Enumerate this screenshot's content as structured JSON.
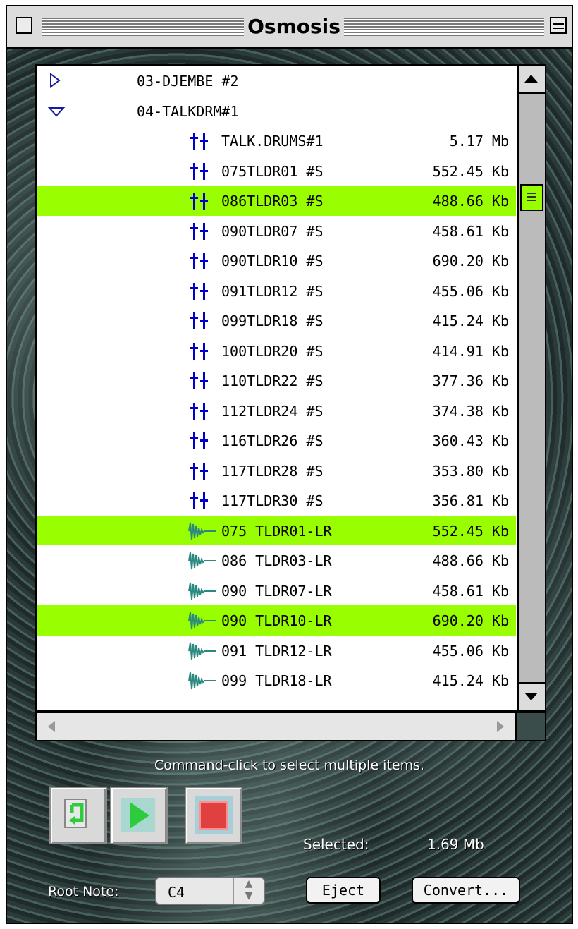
{
  "window": {
    "title": "Osmosis"
  },
  "list": {
    "rows": [
      {
        "kind": "folder",
        "state": "collapsed",
        "name": "03-DJEMBE #2",
        "size": "",
        "selected": false
      },
      {
        "kind": "folder",
        "state": "expanded",
        "name": "04-TALKDRM#1",
        "size": "",
        "selected": false
      },
      {
        "kind": "sample",
        "name": "TALK.DRUMS#1",
        "size": "5.17 Mb",
        "selected": false
      },
      {
        "kind": "sample",
        "name": "075TLDR01 #S",
        "size": "552.45 Kb",
        "selected": false
      },
      {
        "kind": "sample",
        "name": "086TLDR03 #S",
        "size": "488.66 Kb",
        "selected": true
      },
      {
        "kind": "sample",
        "name": "090TLDR07 #S",
        "size": "458.61 Kb",
        "selected": false
      },
      {
        "kind": "sample",
        "name": "090TLDR10 #S",
        "size": "690.20 Kb",
        "selected": false
      },
      {
        "kind": "sample",
        "name": "091TLDR12 #S",
        "size": "455.06 Kb",
        "selected": false
      },
      {
        "kind": "sample",
        "name": "099TLDR18 #S",
        "size": "415.24 Kb",
        "selected": false
      },
      {
        "kind": "sample",
        "name": "100TLDR20 #S",
        "size": "414.91 Kb",
        "selected": false
      },
      {
        "kind": "sample",
        "name": "110TLDR22 #S",
        "size": "377.36 Kb",
        "selected": false
      },
      {
        "kind": "sample",
        "name": "112TLDR24 #S",
        "size": "374.38 Kb",
        "selected": false
      },
      {
        "kind": "sample",
        "name": "116TLDR26 #S",
        "size": "360.43 Kb",
        "selected": false
      },
      {
        "kind": "sample",
        "name": "117TLDR28 #S",
        "size": "353.80 Kb",
        "selected": false
      },
      {
        "kind": "sample",
        "name": "117TLDR30 #S",
        "size": "356.81 Kb",
        "selected": false
      },
      {
        "kind": "wave",
        "name": "075 TLDR01-LR",
        "size": "552.45 Kb",
        "selected": true
      },
      {
        "kind": "wave",
        "name": "086 TLDR03-LR",
        "size": "488.66 Kb",
        "selected": false
      },
      {
        "kind": "wave",
        "name": "090 TLDR07-LR",
        "size": "458.61 Kb",
        "selected": false
      },
      {
        "kind": "wave",
        "name": "090 TLDR10-LR",
        "size": "690.20 Kb",
        "selected": true
      },
      {
        "kind": "wave",
        "name": "091 TLDR12-LR",
        "size": "455.06 Kb",
        "selected": false
      },
      {
        "kind": "wave",
        "name": "099 TLDR18-LR",
        "size": "415.24 Kb",
        "selected": false
      }
    ]
  },
  "hint": "Command-click to select multiple items.",
  "status": {
    "selected_label": "Selected:",
    "selected_value": "1.69 Mb"
  },
  "root_note": {
    "label": "Root Note:",
    "value": "C4"
  },
  "buttons": {
    "eject": "Eject",
    "convert": "Convert..."
  },
  "colors": {
    "selection": "#99ff00",
    "sample_icon": "#0000cc",
    "wave_icon": "#2a8a80"
  }
}
